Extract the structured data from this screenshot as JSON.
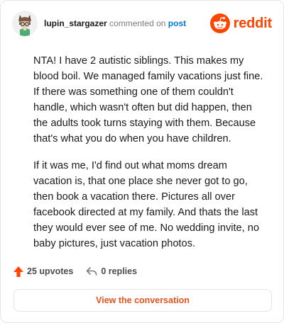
{
  "comment": {
    "username": "lupin_stargazer",
    "action_text": "commented on",
    "post_link_text": "post",
    "paragraphs": [
      "NTA! I have 2 autistic siblings. This makes my blood boil. We managed family vacations just fine. If there was something one of them couldn't handle, which wasn't often but did happen, then the adults took turns staying with them. Because that's what you do when you have children.",
      "If it was me, I'd find out what moms dream vacation is, that one place she never got to go, then book a vacation there. Pictures all over facebook directed at my family. And thats the last they would ever see of me. No wedding invite, no baby pictures, just vacation photos."
    ]
  },
  "brand": {
    "wordmark": "reddit",
    "color": "#ff4500"
  },
  "stats": {
    "upvotes": "25 upvotes",
    "replies": "0 replies"
  },
  "footer": {
    "button_label": "View the conversation"
  },
  "icons": {
    "avatar": "avatar",
    "logo": "reddit-snoo-icon",
    "upvote": "upvote-arrow-icon",
    "reply": "reply-arrow-icon"
  },
  "colors": {
    "link": "#0079d3",
    "accent": "#ff4500",
    "button_text": "#e4541e",
    "border": "#e3e6e8"
  }
}
